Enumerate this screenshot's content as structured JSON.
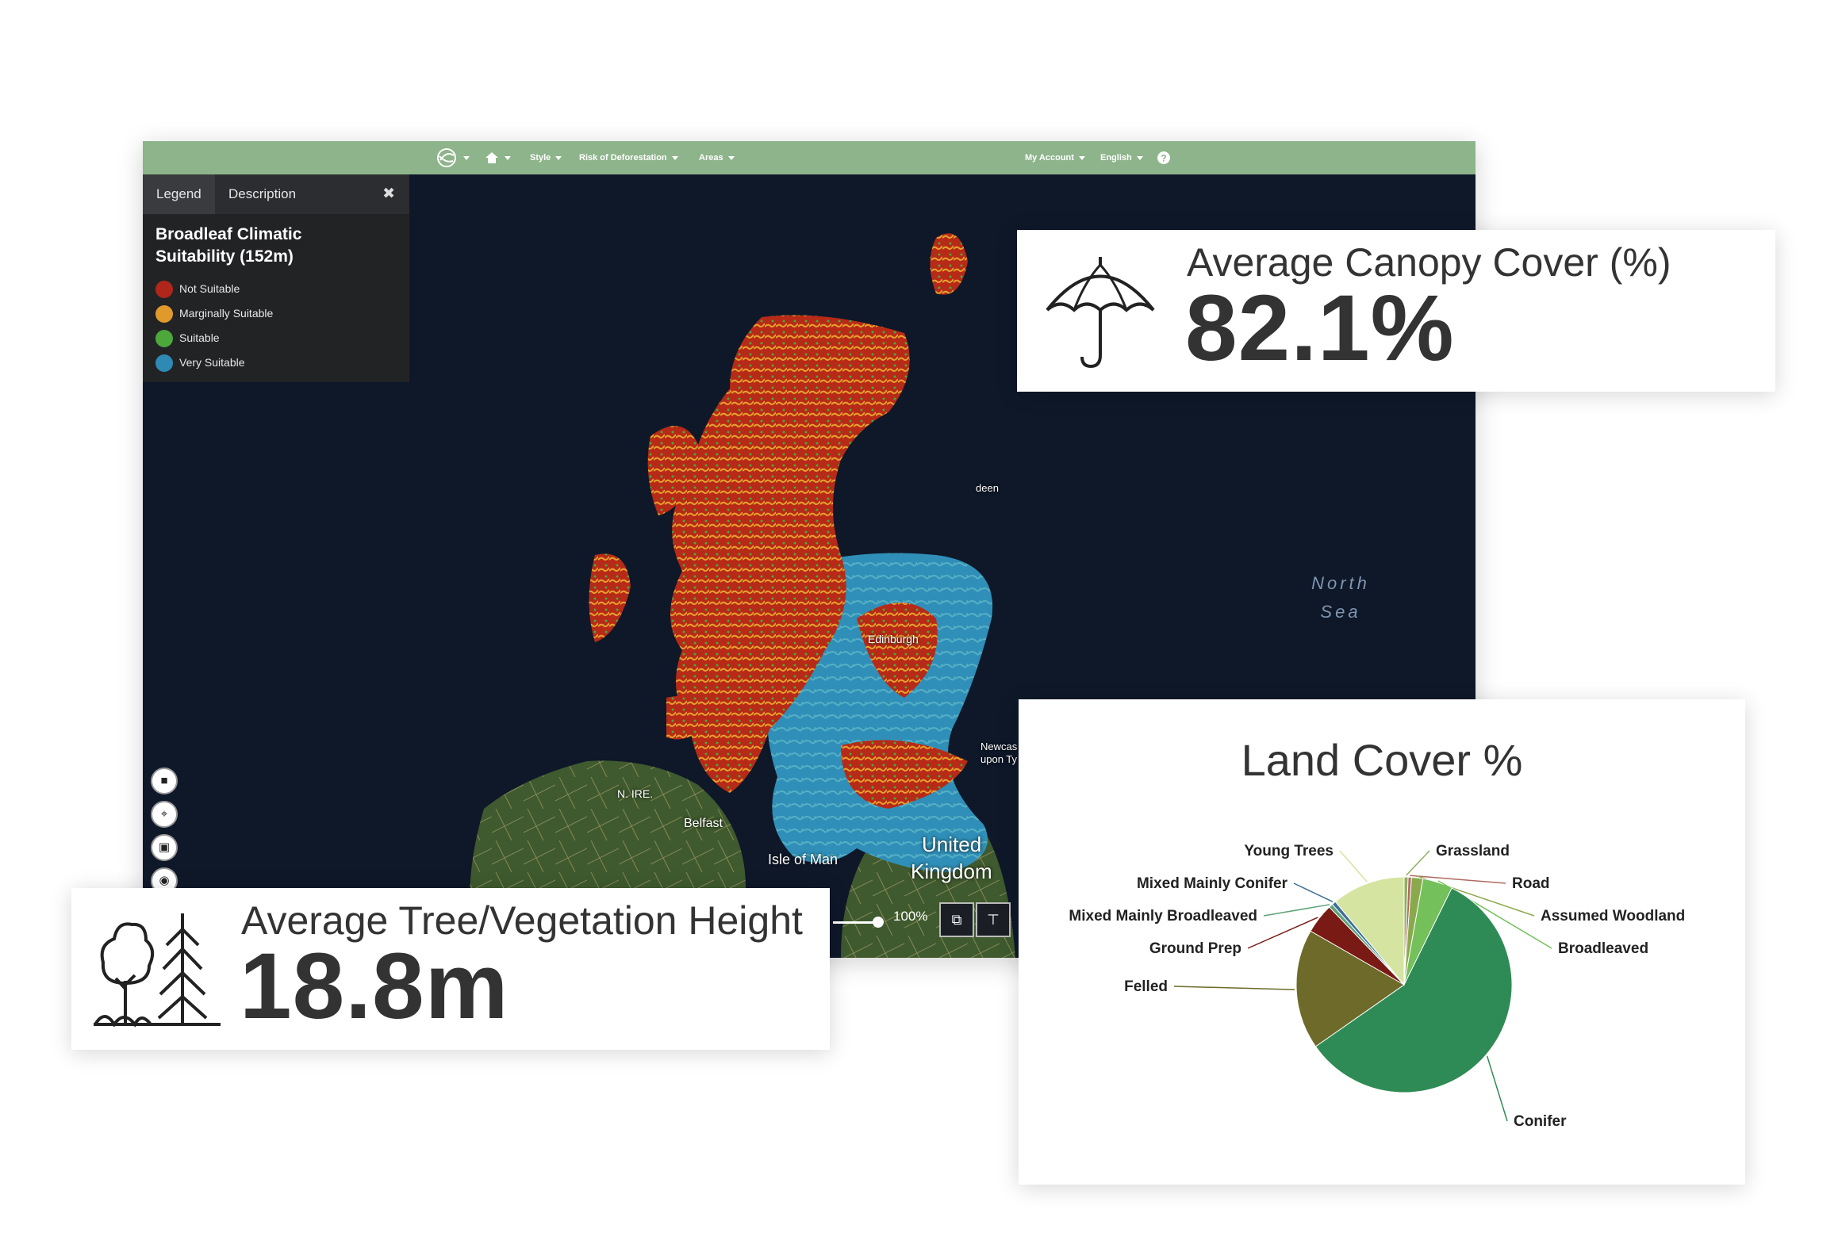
{
  "nav": {
    "style": "Style",
    "risk": "Risk of Deforestation",
    "areas": "Areas",
    "account": "My Account",
    "language": "English",
    "icons": [
      "logo-icon",
      "home-icon",
      "help-icon"
    ]
  },
  "legend": {
    "tab_legend": "Legend",
    "tab_description": "Description",
    "close": "✖",
    "title": "Broadleaf Climatic Suitability (152m)",
    "items": [
      {
        "label": "Not Suitable",
        "color": "#b0261b"
      },
      {
        "label": "Marginally Suitable",
        "color": "#e09a2c"
      },
      {
        "label": "Suitable",
        "color": "#4ca83a"
      },
      {
        "label": "Very Suitable",
        "color": "#2e8ab5"
      }
    ]
  },
  "map": {
    "labels": {
      "n_ire": "N. IRE.",
      "belfast": "Belfast",
      "isle_of_man": "Isle of Man",
      "united_kingdom_1": "United",
      "united_kingdom_2": "Kingdom",
      "north_sea_1": "North",
      "north_sea_2": "Sea",
      "edinburgh": "Edinburgh",
      "aberdeen": "deen",
      "newcastle_1": "Newcas",
      "newcastle_2": "upon Ty"
    },
    "zoom": "100%"
  },
  "canopy": {
    "title": "Average Canopy Cover (%)",
    "value": "82.1%"
  },
  "height": {
    "title": "Average Tree/Vegetation Height",
    "value": "18.8m"
  },
  "chart_data": {
    "type": "pie",
    "title": "Land Cover %",
    "slices": [
      {
        "label": "Conifer",
        "value": 58.0,
        "color": "#2f8b55"
      },
      {
        "label": "Felled",
        "value": 18.0,
        "color": "#6e6b2a"
      },
      {
        "label": "Ground Prep",
        "value": 4.5,
        "color": "#7a1a14"
      },
      {
        "label": "Mixed Mainly Broadleaved",
        "value": 0.6,
        "color": "#5ea37a"
      },
      {
        "label": "Mixed Mainly Conifer",
        "value": 0.6,
        "color": "#3b6f98"
      },
      {
        "label": "Young Trees",
        "value": 11.0,
        "color": "#d5e4a0"
      },
      {
        "label": "Grassland",
        "value": 0.6,
        "color": "#8fb060"
      },
      {
        "label": "Road",
        "value": 0.5,
        "color": "#b06a60"
      },
      {
        "label": "Assumed Woodland",
        "value": 1.7,
        "color": "#8aa94c"
      },
      {
        "label": "Broadleaved",
        "value": 4.5,
        "color": "#74c05a"
      }
    ]
  }
}
